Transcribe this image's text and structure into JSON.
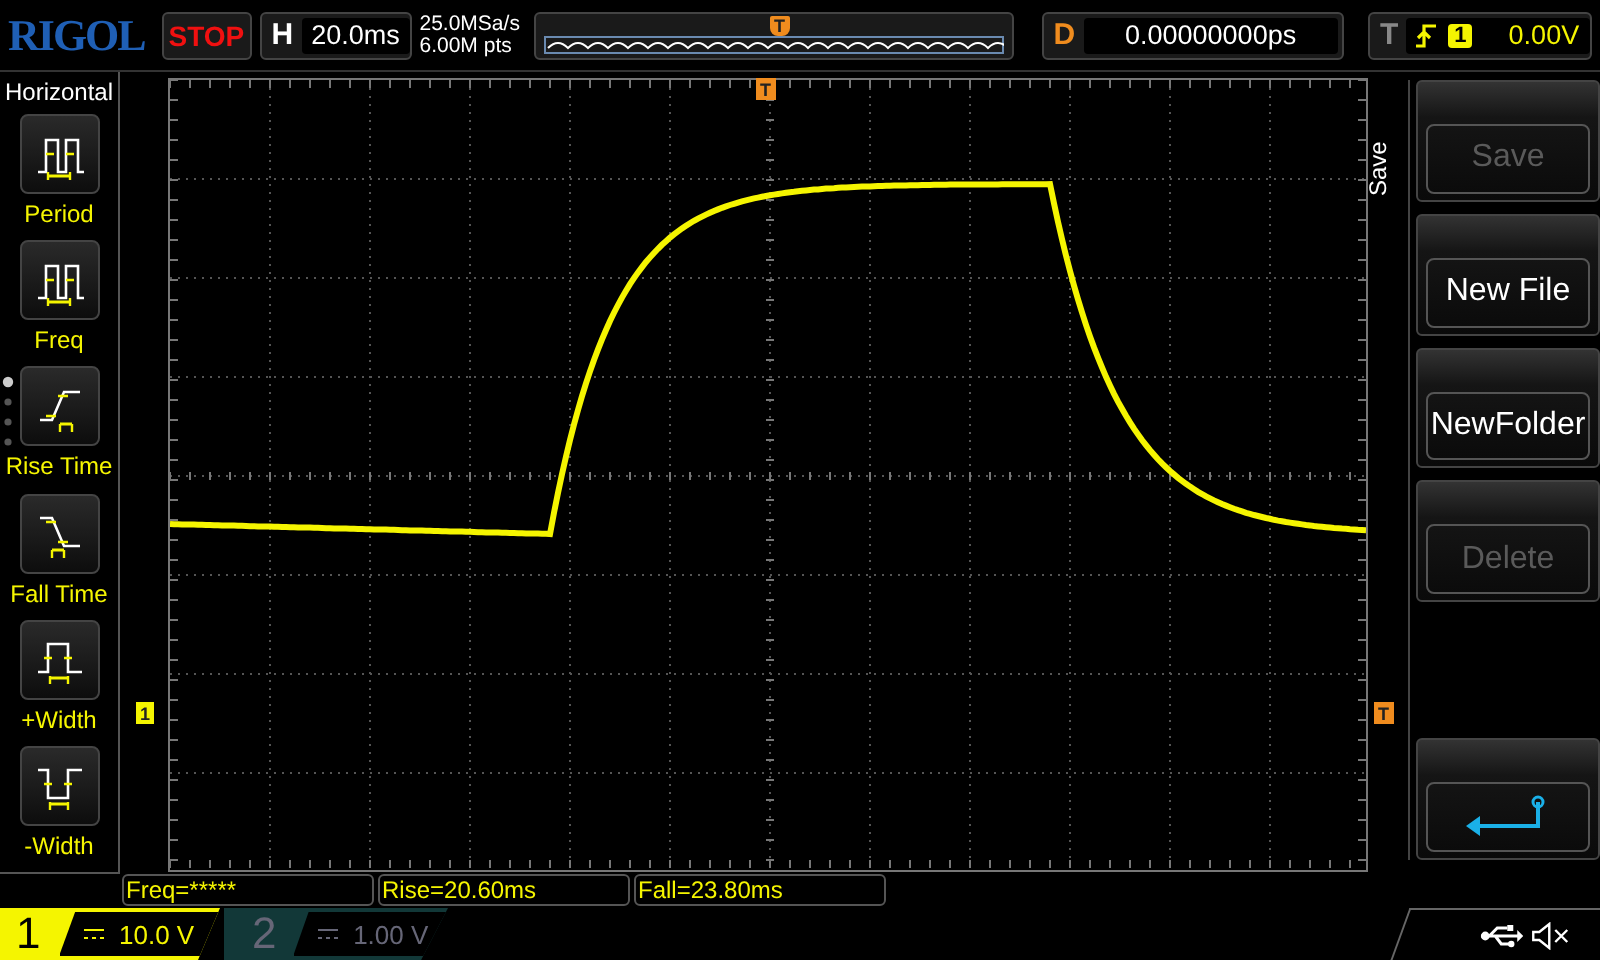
{
  "header": {
    "logo": "RIGOL",
    "run_state": "STOP",
    "horizontal": {
      "label": "H",
      "timebase": "20.0ms"
    },
    "sample_rate": "25.0MSa/s",
    "memory_depth": "6.00M pts",
    "delay": {
      "label": "D",
      "value": "0.00000000ps"
    },
    "trigger": {
      "label": "T",
      "source": "1",
      "level": "0.00V"
    }
  },
  "left_menu": {
    "title": "Horizontal",
    "items": [
      {
        "kind": "period",
        "label": "Period"
      },
      {
        "kind": "freq",
        "label": "Freq"
      },
      {
        "kind": "rise",
        "label": "Rise Time"
      },
      {
        "kind": "fall",
        "label": "Fall Time"
      },
      {
        "kind": "pwidth",
        "label": "+Width"
      },
      {
        "kind": "nwidth",
        "label": "-Width"
      }
    ]
  },
  "markers": {
    "overview_trigger": "T",
    "trigger_position": "T",
    "channel": "1",
    "trigger_level": "T"
  },
  "right_menu": {
    "title": "Save",
    "buttons": [
      {
        "kind": "text",
        "label": "Save",
        "disabled": true
      },
      {
        "kind": "text",
        "label": "New File",
        "disabled": false
      },
      {
        "kind": "text",
        "label": "NewFolder",
        "disabled": false
      },
      {
        "kind": "text",
        "label": "Delete",
        "disabled": true
      },
      {
        "kind": "back"
      }
    ]
  },
  "measurements": [
    "Freq=*****",
    "Rise=20.60ms",
    "Fall=23.80ms"
  ],
  "channels": [
    {
      "number": "1",
      "scale": "10.0 V",
      "selected": true
    },
    {
      "number": "2",
      "scale": "1.00 V",
      "selected": false
    }
  ]
}
